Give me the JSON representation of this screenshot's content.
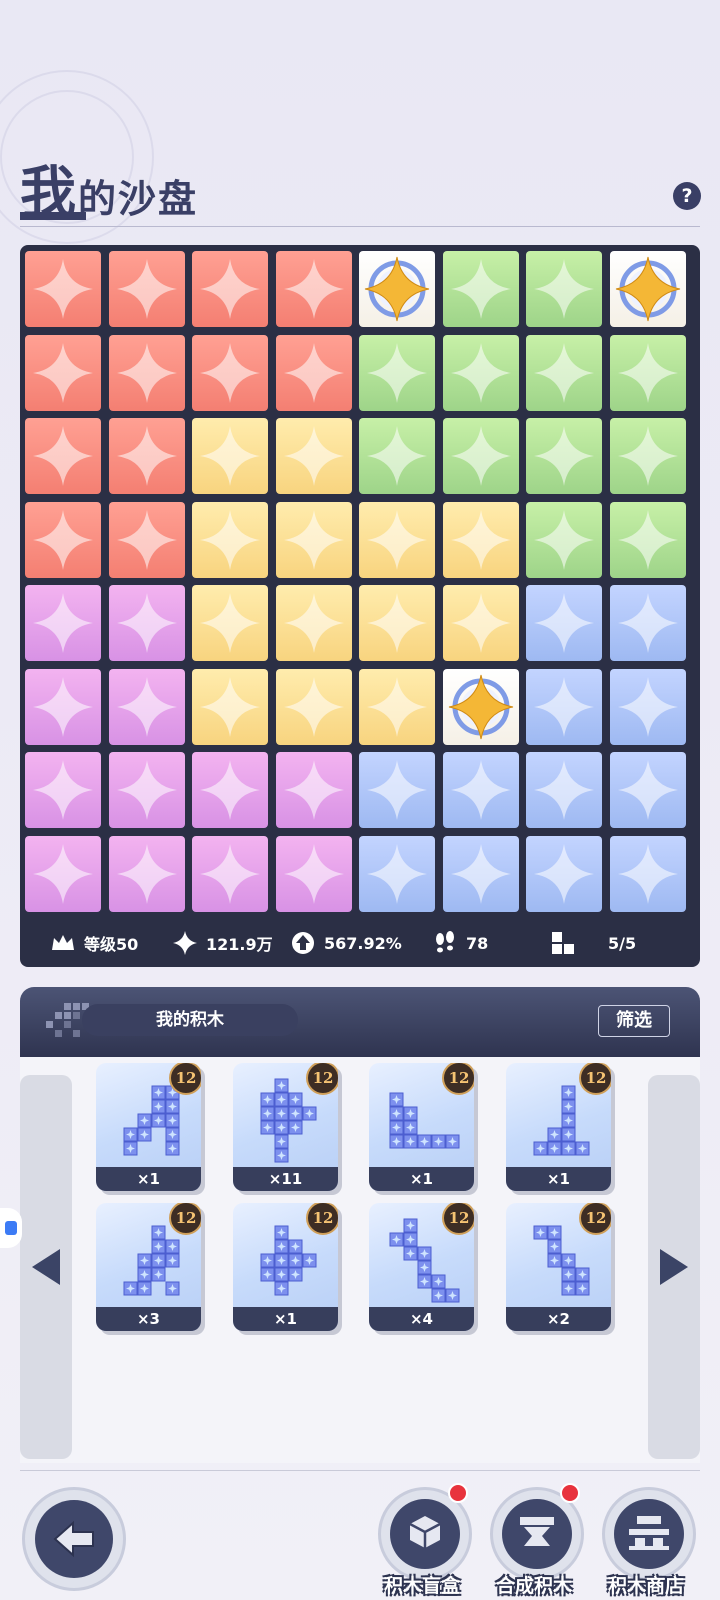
{
  "header": {
    "title_big": "我",
    "title_rest": "的沙盘",
    "help_icon": "?"
  },
  "board": {
    "rows": [
      [
        "red",
        "red",
        "red",
        "red",
        "special",
        "green",
        "green",
        "special"
      ],
      [
        "red",
        "red",
        "red",
        "red",
        "green",
        "green",
        "green",
        "green"
      ],
      [
        "red",
        "red",
        "yellow",
        "yellow",
        "green",
        "green",
        "green",
        "green"
      ],
      [
        "red",
        "red",
        "yellow",
        "yellow",
        "yellow",
        "yellow",
        "green",
        "green"
      ],
      [
        "purple",
        "purple",
        "yellow",
        "yellow",
        "yellow",
        "yellow",
        "blue",
        "blue"
      ],
      [
        "purple",
        "purple",
        "yellow",
        "yellow",
        "yellow",
        "special",
        "blue",
        "blue"
      ],
      [
        "purple",
        "purple",
        "purple",
        "purple",
        "blue",
        "blue",
        "blue",
        "blue"
      ],
      [
        "purple",
        "purple",
        "purple",
        "purple",
        "blue",
        "blue",
        "blue",
        "blue"
      ]
    ],
    "stats": {
      "level": "等级50",
      "power": "121.9万",
      "bonus": "567.92%",
      "steps": "78",
      "blocks": "5/5"
    }
  },
  "blocks_panel": {
    "title": "我的积木",
    "filter_label": "筛选",
    "cards": [
      {
        "level": "12",
        "count": "×1",
        "shape": [
          [
            0,
            2
          ],
          [
            0,
            3
          ],
          [
            1,
            2
          ],
          [
            1,
            3
          ],
          [
            2,
            1
          ],
          [
            2,
            2
          ],
          [
            2,
            3
          ],
          [
            3,
            0
          ],
          [
            3,
            1
          ],
          [
            3,
            3
          ],
          [
            4,
            0
          ],
          [
            4,
            3
          ]
        ]
      },
      {
        "level": "12",
        "count": "×11",
        "shape": [
          [
            0,
            1
          ],
          [
            1,
            0
          ],
          [
            1,
            1
          ],
          [
            1,
            2
          ],
          [
            2,
            0
          ],
          [
            2,
            1
          ],
          [
            2,
            2
          ],
          [
            2,
            3
          ],
          [
            3,
            0
          ],
          [
            3,
            1
          ],
          [
            3,
            2
          ],
          [
            4,
            1
          ],
          [
            5,
            1
          ]
        ]
      },
      {
        "level": "12",
        "count": "×1",
        "shape": [
          [
            0,
            0
          ],
          [
            1,
            0
          ],
          [
            1,
            1
          ],
          [
            2,
            0
          ],
          [
            2,
            1
          ],
          [
            3,
            0
          ],
          [
            3,
            1
          ],
          [
            3,
            2
          ],
          [
            3,
            3
          ],
          [
            3,
            4
          ]
        ]
      },
      {
        "level": "12",
        "count": "×1",
        "shape": [
          [
            0,
            2
          ],
          [
            1,
            2
          ],
          [
            2,
            2
          ],
          [
            3,
            1
          ],
          [
            3,
            2
          ],
          [
            4,
            0
          ],
          [
            4,
            1
          ],
          [
            4,
            2
          ],
          [
            4,
            3
          ]
        ]
      },
      {
        "level": "12",
        "count": "×3",
        "shape": [
          [
            0,
            2
          ],
          [
            1,
            2
          ],
          [
            1,
            3
          ],
          [
            2,
            1
          ],
          [
            2,
            2
          ],
          [
            2,
            3
          ],
          [
            3,
            1
          ],
          [
            3,
            2
          ],
          [
            4,
            0
          ],
          [
            4,
            1
          ],
          [
            4,
            3
          ]
        ]
      },
      {
        "level": "12",
        "count": "×1",
        "shape": [
          [
            0,
            1
          ],
          [
            1,
            1
          ],
          [
            1,
            2
          ],
          [
            2,
            0
          ],
          [
            2,
            1
          ],
          [
            2,
            2
          ],
          [
            2,
            3
          ],
          [
            3,
            0
          ],
          [
            3,
            1
          ],
          [
            3,
            2
          ],
          [
            4,
            1
          ]
        ]
      },
      {
        "level": "12",
        "count": "×4",
        "shape": [
          [
            0,
            1
          ],
          [
            1,
            0
          ],
          [
            1,
            1
          ],
          [
            2,
            1
          ],
          [
            2,
            2
          ],
          [
            3,
            2
          ],
          [
            4,
            2
          ],
          [
            4,
            3
          ],
          [
            5,
            3
          ],
          [
            5,
            4
          ]
        ]
      },
      {
        "level": "12",
        "count": "×2",
        "shape": [
          [
            0,
            0
          ],
          [
            0,
            1
          ],
          [
            1,
            1
          ],
          [
            2,
            1
          ],
          [
            2,
            2
          ],
          [
            3,
            2
          ],
          [
            3,
            3
          ],
          [
            4,
            2
          ],
          [
            4,
            3
          ]
        ]
      }
    ]
  },
  "bottom_nav": {
    "items": [
      {
        "label": "积木盲盒",
        "has_dot": true,
        "icon": "cube-icon"
      },
      {
        "label": "合成积木",
        "has_dot": true,
        "icon": "merge-icon"
      },
      {
        "label": "积木商店",
        "has_dot": false,
        "icon": "shop-icon"
      }
    ]
  },
  "colors": {
    "red": "#f47f72",
    "green": "#9ed489",
    "yellow": "#f8d47f",
    "purple": "#d892e5",
    "blue": "#9eb9f2",
    "dark": "#2b2f45"
  }
}
